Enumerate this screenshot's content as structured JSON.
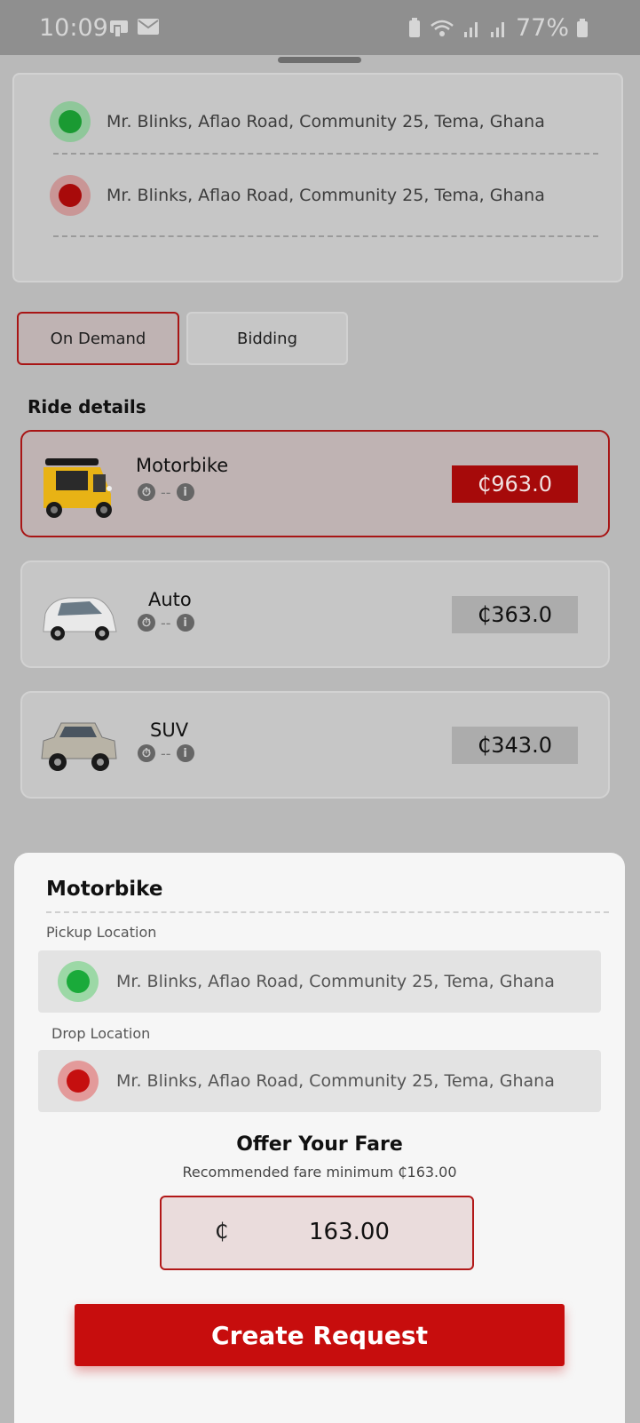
{
  "status_bar": {
    "time": "10:09",
    "battery": "77%"
  },
  "route": {
    "pickup": "Mr. Blinks, Aflao Road, Community 25, Tema, Ghana",
    "drop": "Mr. Blinks, Aflao Road, Community 25, Tema, Ghana"
  },
  "modes": {
    "on_demand": "On Demand",
    "bidding": "Bidding",
    "selected": "On Demand"
  },
  "ride_details": {
    "title": "Ride details",
    "rides": [
      {
        "name": "Motorbike",
        "eta": "--",
        "price": "₵963.0",
        "icon": "tuk-tuk-icon",
        "selected": true
      },
      {
        "name": "Auto",
        "eta": "--",
        "price": "₵363.0",
        "icon": "minivan-icon",
        "selected": false
      },
      {
        "name": "SUV",
        "eta": "--",
        "price": "₵343.0",
        "icon": "suv-icon",
        "selected": false
      }
    ]
  },
  "sheet": {
    "title": "Motorbike",
    "pickup_label": "Pickup Location",
    "pickup_value": "Mr. Blinks, Aflao Road, Community 25, Tema, Ghana",
    "drop_label": "Drop Location",
    "drop_value": "Mr. Blinks, Aflao Road, Community 25, Tema, Ghana",
    "offer_title": "Offer Your Fare",
    "recommended": "Recommended fare minimum ₵163.00",
    "currency": "₵",
    "fare_value": "163.00",
    "create_button": "Create Request"
  },
  "colors": {
    "accent": "#c70d0d",
    "pickup_dot": "#1aaa3a",
    "drop_dot": "#c50f0f"
  }
}
